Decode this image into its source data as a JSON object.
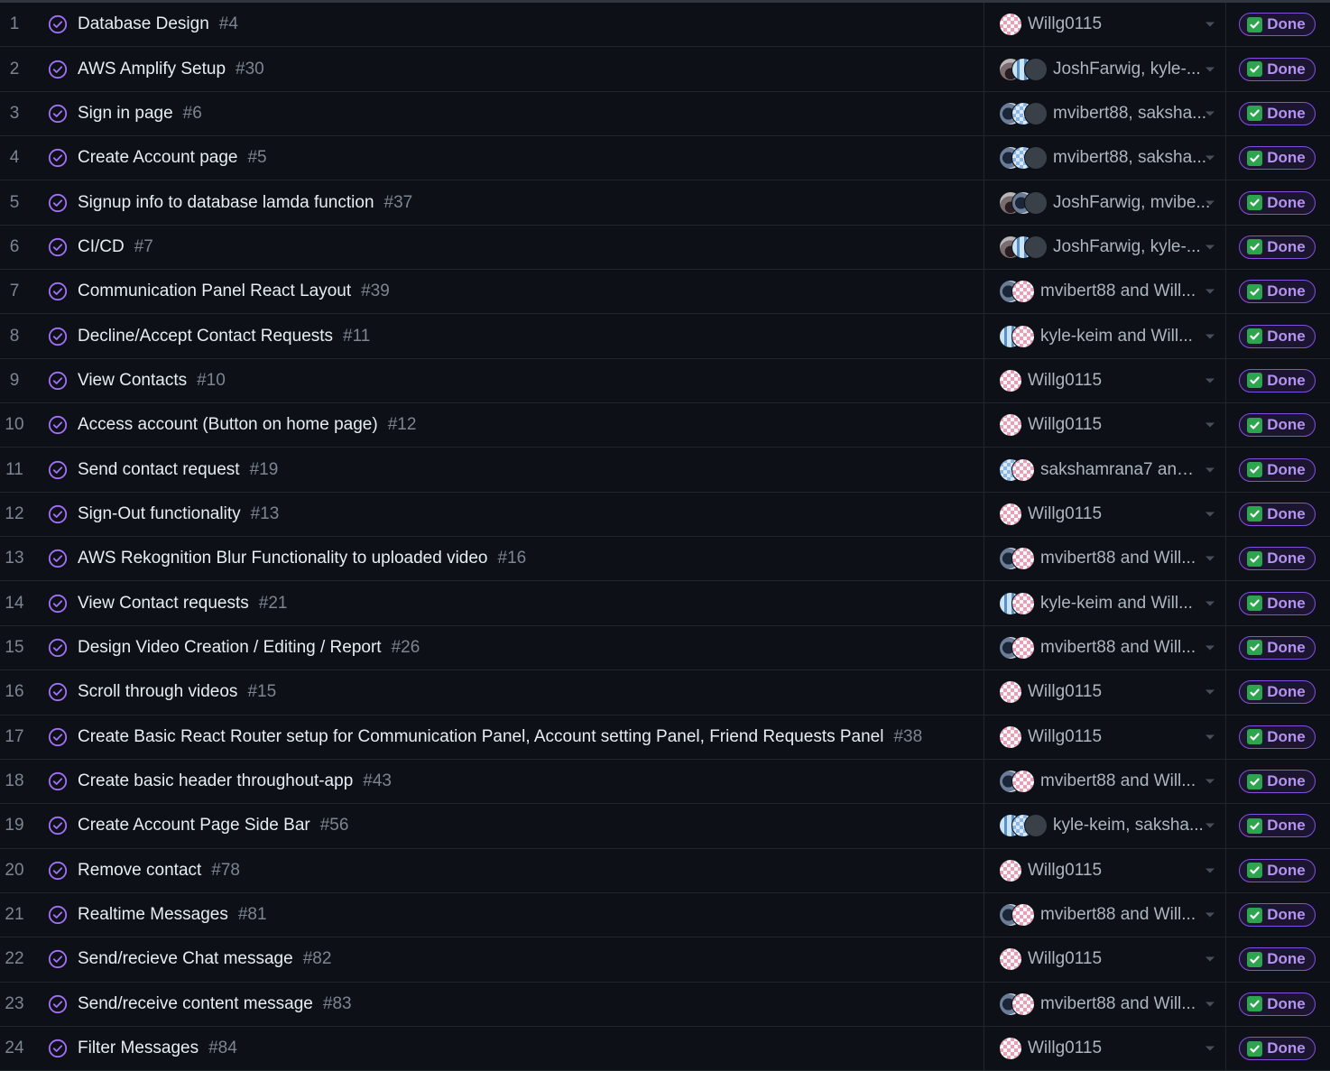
{
  "status_label": "Done",
  "colors": {
    "background": "#0d1117",
    "accent": "#8250df",
    "done_check": "#2da44e"
  },
  "rows": [
    {
      "num": "1",
      "title": "Database Design",
      "issue": "#4",
      "avatars": [
        "willg"
      ],
      "assignees": "Willg0115"
    },
    {
      "num": "2",
      "title": "AWS Amplify Setup",
      "issue": "#30",
      "avatars": [
        "josh",
        "kyle",
        "grey"
      ],
      "assignees": "JoshFarwig, kyle-..."
    },
    {
      "num": "3",
      "title": "Sign in page",
      "issue": "#6",
      "avatars": [
        "mvibert",
        "saksh",
        "grey"
      ],
      "assignees": "mvibert88, saksha..."
    },
    {
      "num": "4",
      "title": "Create Account page",
      "issue": "#5",
      "avatars": [
        "mvibert",
        "saksh",
        "grey"
      ],
      "assignees": "mvibert88, saksha..."
    },
    {
      "num": "5",
      "title": "Signup info to database lamda function",
      "issue": "#37",
      "avatars": [
        "josh",
        "mvibert",
        "grey"
      ],
      "assignees": "JoshFarwig, mvibe..."
    },
    {
      "num": "6",
      "title": "CI/CD",
      "issue": "#7",
      "avatars": [
        "josh",
        "kyle",
        "grey"
      ],
      "assignees": "JoshFarwig, kyle-..."
    },
    {
      "num": "7",
      "title": "Communication Panel React Layout",
      "issue": "#39",
      "avatars": [
        "mvibert",
        "willg"
      ],
      "assignees": "mvibert88 and Will..."
    },
    {
      "num": "8",
      "title": "Decline/Accept Contact Requests",
      "issue": "#11",
      "avatars": [
        "kyle",
        "willg"
      ],
      "assignees": "kyle-keim and Will..."
    },
    {
      "num": "9",
      "title": "View Contacts",
      "issue": "#10",
      "avatars": [
        "willg"
      ],
      "assignees": "Willg0115"
    },
    {
      "num": "10",
      "title": "Access account (Button on home page)",
      "issue": "#12",
      "avatars": [
        "willg"
      ],
      "assignees": "Willg0115"
    },
    {
      "num": "11",
      "title": "Send contact request",
      "issue": "#19",
      "avatars": [
        "saksh",
        "willg"
      ],
      "assignees": "sakshamrana7 and..."
    },
    {
      "num": "12",
      "title": "Sign-Out functionality",
      "issue": "#13",
      "avatars": [
        "willg"
      ],
      "assignees": "Willg0115"
    },
    {
      "num": "13",
      "title": "AWS Rekognition Blur Functionality to uploaded video",
      "issue": "#16",
      "avatars": [
        "mvibert",
        "willg"
      ],
      "assignees": "mvibert88 and Will..."
    },
    {
      "num": "14",
      "title": "View Contact requests",
      "issue": "#21",
      "avatars": [
        "kyle",
        "willg"
      ],
      "assignees": "kyle-keim and Will..."
    },
    {
      "num": "15",
      "title": "Design Video Creation / Editing / Report",
      "issue": "#26",
      "avatars": [
        "mvibert",
        "willg"
      ],
      "assignees": "mvibert88 and Will..."
    },
    {
      "num": "16",
      "title": "Scroll through videos",
      "issue": "#15",
      "avatars": [
        "willg"
      ],
      "assignees": "Willg0115"
    },
    {
      "num": "17",
      "title": "Create Basic React Router setup for Communication Panel, Account setting Panel, Friend Requests Panel",
      "issue": "#38",
      "avatars": [
        "willg"
      ],
      "assignees": "Willg0115"
    },
    {
      "num": "18",
      "title": "Create basic header throughout-app",
      "issue": "#43",
      "avatars": [
        "mvibert",
        "willg"
      ],
      "assignees": "mvibert88 and Will..."
    },
    {
      "num": "19",
      "title": "Create Account Page Side Bar",
      "issue": "#56",
      "avatars": [
        "kyle",
        "saksh",
        "grey"
      ],
      "assignees": "kyle-keim, saksha..."
    },
    {
      "num": "20",
      "title": "Remove contact",
      "issue": "#78",
      "avatars": [
        "willg"
      ],
      "assignees": "Willg0115"
    },
    {
      "num": "21",
      "title": "Realtime Messages",
      "issue": "#81",
      "avatars": [
        "mvibert",
        "willg"
      ],
      "assignees": "mvibert88 and Will..."
    },
    {
      "num": "22",
      "title": "Send/recieve Chat message",
      "issue": "#82",
      "avatars": [
        "willg"
      ],
      "assignees": "Willg0115"
    },
    {
      "num": "23",
      "title": "Send/receive content message",
      "issue": "#83",
      "avatars": [
        "mvibert",
        "willg"
      ],
      "assignees": "mvibert88 and Will..."
    },
    {
      "num": "24",
      "title": "Filter Messages",
      "issue": "#84",
      "avatars": [
        "willg"
      ],
      "assignees": "Willg0115"
    }
  ]
}
